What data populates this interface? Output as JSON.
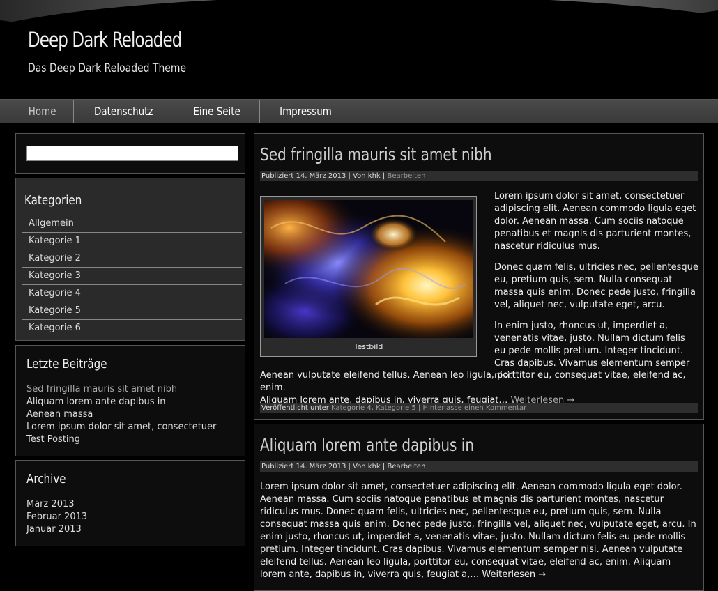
{
  "site": {
    "title": "Deep Dark Reloaded",
    "description": "Das Deep Dark Reloaded Theme"
  },
  "nav": [
    "Home",
    "Datenschutz",
    "Eine Seite",
    "Impressum"
  ],
  "sidebar": {
    "search": {
      "placeholder": ""
    },
    "categories": {
      "title": "Kategorien",
      "items": [
        "Allgemein",
        "Kategorie 1",
        "Kategorie 2",
        "Kategorie 3",
        "Kategorie 4",
        "Kategorie 5",
        "Kategorie 6"
      ]
    },
    "recent": {
      "title": "Letzte Beiträge",
      "items": [
        "Sed fringilla mauris sit amet nibh",
        "Aliquam lorem ante dapibus in",
        "Aenean massa",
        "Lorem ipsum dolor sit amet, consectetuer",
        "Test Posting"
      ]
    },
    "archive": {
      "title": "Archive",
      "items": [
        "März 2013",
        "Februar 2013",
        "Januar 2013"
      ]
    }
  },
  "posts": [
    {
      "title": "Sed fringilla mauris sit amet nibh",
      "meta": {
        "published_label": "Publiziert",
        "date": "14. März 2013",
        "sep1": "|",
        "by_label": "Von",
        "author": "khk",
        "sep2": "|",
        "edit": "Bearbeiten"
      },
      "image_caption": "Testbild",
      "paragraphs": [
        "Lorem ipsum dolor sit amet, consectetuer adipiscing elit. Aenean commodo ligula eget dolor. Aenean massa. Cum sociis natoque penatibus et magnis dis parturient montes, nascetur ridiculus mus.",
        "Donec quam felis, ultricies nec, pellentesque eu, pretium quis, sem. Nulla consequat massa quis enim. Donec pede justo, fringilla vel, aliquet nec, vulputate eget, arcu.",
        "In enim justo, rhoncus ut, imperdiet a, venenatis vitae, justo. Nullam dictum felis eu pede mollis pretium. Integer tincidunt. Cras dapibus. Vivamus elementum semper nisi.",
        "Aenean vulputate eleifend tellus. Aenean leo ligula, porttitor eu, consequat vitae, eleifend ac, enim.",
        "Aliquam lorem ante, dapibus in, viverra quis, feugiat…"
      ],
      "more": "Weiterlesen →",
      "footer": {
        "label": "Veröffentlicht unter",
        "cat1": "Kategorie 4",
        "comma": ",",
        "cat2": "Kategorie 5",
        "sep": "|",
        "comment": "Hinterlasse einen Kommentar"
      }
    },
    {
      "title": "Aliquam lorem ante dapibus in",
      "meta": {
        "published_label": "Publiziert",
        "date": "14. März 2013",
        "sep1": "|",
        "by_label": "Von",
        "author": "khk",
        "sep2": "|",
        "edit": "Bearbeiten"
      },
      "body": "Lorem ipsum dolor sit amet, consectetuer adipiscing elit. Aenean commodo ligula eget dolor. Aenean massa. Cum sociis natoque penatibus et magnis dis parturient montes, nascetur ridiculus mus. Donec quam felis, ultricies nec, pellentesque eu, pretium quis, sem. Nulla consequat massa quis enim. Donec pede justo, fringilla vel, aliquet nec, vulputate eget, arcu. In enim justo, rhoncus ut, imperdiet a, venenatis vitae, justo. Nullam dictum felis eu pede mollis pretium. Integer tincidunt. Cras dapibus. Vivamus elementum semper nisi. Aenean vulputate eleifend tellus. Aenean leo ligula, porttitor eu, consequat vitae, eleifend ac, enim. Aliquam lorem ante, dapibus in, viverra quis, feugiat a,…",
      "more": "Weiterlesen →"
    }
  ]
}
